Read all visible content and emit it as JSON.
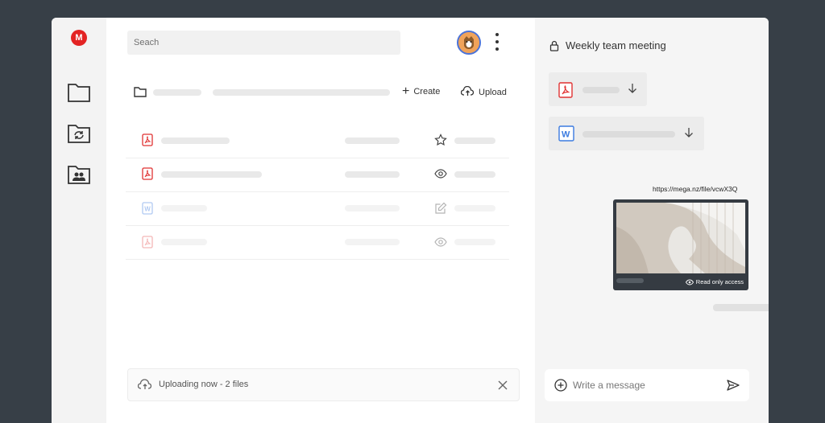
{
  "sidebar": {
    "logo_letter": "M",
    "items": [
      {
        "icon": "folder-icon"
      },
      {
        "icon": "sync-folder-icon"
      },
      {
        "icon": "shared-folder-icon"
      }
    ]
  },
  "header": {
    "search_placeholder": "Seach",
    "avatar": "user-avatar",
    "menu_icon": "kebab-menu-icon"
  },
  "toolbar": {
    "create_label": "Create",
    "upload_label": "Upload"
  },
  "files": [
    {
      "type": "pdf",
      "status_icon": "star-icon"
    },
    {
      "type": "pdf",
      "status_icon": "eye-icon"
    },
    {
      "type": "word",
      "status_icon": "edit-icon"
    },
    {
      "type": "pdf",
      "status_icon": "eye-icon"
    }
  ],
  "upload_status": {
    "text": "Uploading now - 2 files"
  },
  "chat": {
    "title": "Weekly team meeting",
    "attachments": [
      {
        "type": "pdf",
        "icon": "download-icon"
      },
      {
        "type": "word",
        "icon": "download-icon"
      }
    ],
    "shared_link": "https://mega.nz/file/vcwX3Q",
    "preview_badge": "Read only access",
    "composer_placeholder": "Write a message"
  },
  "colors": {
    "background": "#373f47",
    "brand_red": "#e32323",
    "word_blue": "#3b7be0",
    "pdf_red": "#e03232"
  }
}
